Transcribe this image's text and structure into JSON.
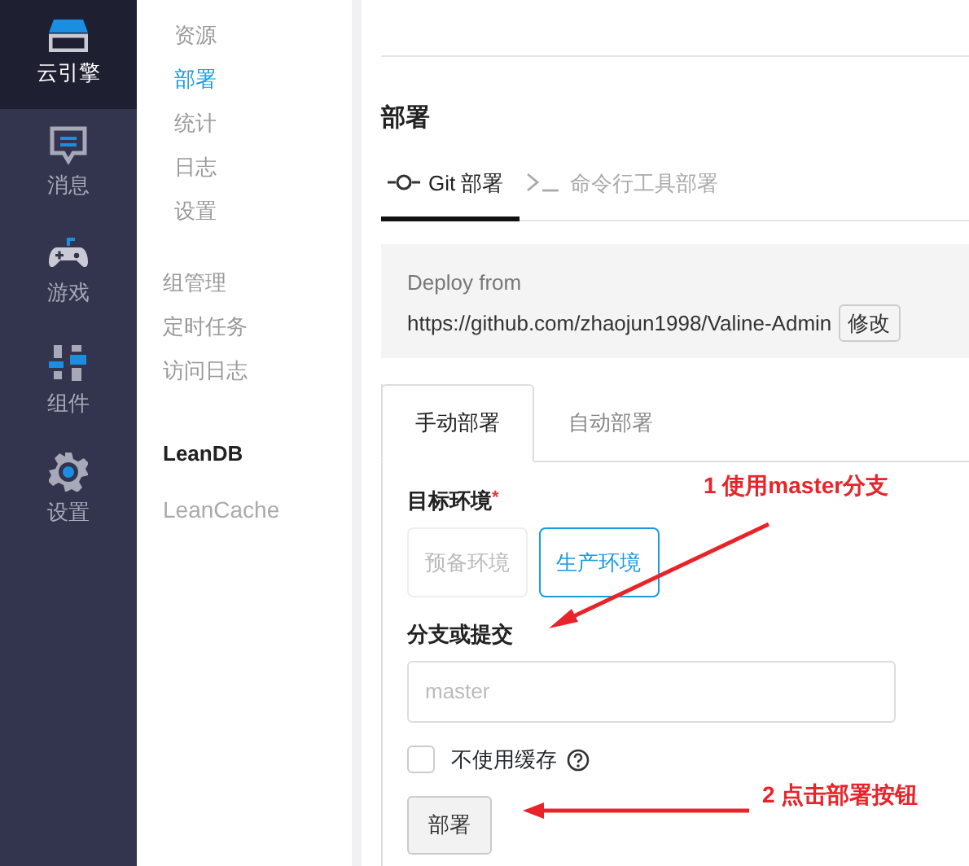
{
  "icon_nav": [
    {
      "kind": "engine",
      "label": "云引擎",
      "selected": true
    },
    {
      "kind": "message",
      "label": "消息",
      "selected": false
    },
    {
      "kind": "game",
      "label": "游戏",
      "selected": false
    },
    {
      "kind": "component",
      "label": "组件",
      "selected": false
    },
    {
      "kind": "settings",
      "label": "设置",
      "selected": false
    }
  ],
  "sub_nav": {
    "groups": [
      {
        "items": [
          {
            "label": "资源",
            "selected": false
          },
          {
            "label": "部署",
            "selected": true
          },
          {
            "label": "统计",
            "selected": false
          },
          {
            "label": "日志",
            "selected": false
          },
          {
            "label": "设置",
            "selected": false
          }
        ]
      },
      {
        "items": [
          {
            "label": "组管理",
            "selected": false
          },
          {
            "label": "定时任务",
            "selected": false
          },
          {
            "label": "访问日志",
            "selected": false
          }
        ]
      }
    ],
    "db_heading": "LeanDB",
    "db_link": "LeanCache"
  },
  "main": {
    "title": "部署",
    "tabs": [
      {
        "kind": "git",
        "label": "Git 部署",
        "selected": true
      },
      {
        "kind": "cli",
        "label": "命令行工具部署",
        "selected": false
      }
    ],
    "deploy_source": {
      "label": "Deploy from",
      "url": "https://github.com/zhaojun1998/Valine-Admin",
      "button": "修改"
    },
    "mode_tabs": [
      {
        "label": "手动部署",
        "selected": true
      },
      {
        "label": "自动部署",
        "selected": false
      }
    ],
    "target_env": {
      "label": "目标环境",
      "required_mark": "*",
      "options": [
        {
          "label": "预备环境",
          "selected": false
        },
        {
          "label": "生产环境",
          "selected": true
        }
      ]
    },
    "branch": {
      "label": "分支或提交",
      "placeholder": "master"
    },
    "no_cache": {
      "label": "不使用缓存",
      "checked": false
    },
    "deploy_button": "部署"
  },
  "annotations": [
    {
      "text": "1 使用master分支"
    },
    {
      "text": "2 点击部署按钮"
    }
  ]
}
